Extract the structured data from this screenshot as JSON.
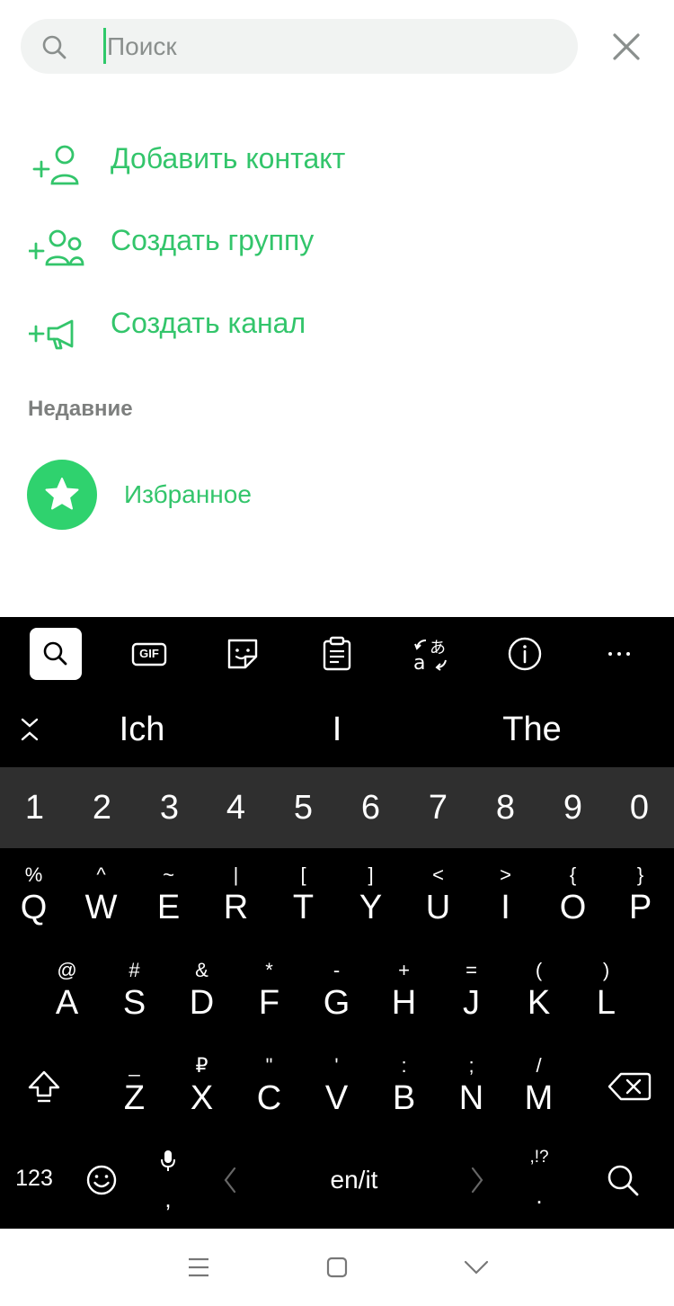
{
  "search": {
    "placeholder": "Поиск"
  },
  "actions": [
    {
      "label": "Добавить контакт",
      "icon": "add-contact-icon"
    },
    {
      "label": "Создать группу",
      "icon": "add-group-icon"
    },
    {
      "label": "Создать канал",
      "icon": "add-channel-icon"
    }
  ],
  "recent": {
    "title": "Недавние",
    "items": [
      {
        "label": "Избранное",
        "icon": "star-icon"
      }
    ]
  },
  "keyboard": {
    "toolbar": [
      "search-icon",
      "gif-icon",
      "sticker-icon",
      "clipboard-icon",
      "translate-icon",
      "info-icon",
      "more-icon"
    ],
    "gif_label": "GIF",
    "suggestions": [
      "Ich",
      "I",
      "The"
    ],
    "numbers": [
      "1",
      "2",
      "3",
      "4",
      "5",
      "6",
      "7",
      "8",
      "9",
      "0"
    ],
    "row1": [
      {
        "main": "Q",
        "sec": "%"
      },
      {
        "main": "W",
        "sec": "^"
      },
      {
        "main": "E",
        "sec": "~"
      },
      {
        "main": "R",
        "sec": "|"
      },
      {
        "main": "T",
        "sec": "["
      },
      {
        "main": "Y",
        "sec": "]"
      },
      {
        "main": "U",
        "sec": "<"
      },
      {
        "main": "I",
        "sec": ">"
      },
      {
        "main": "O",
        "sec": "{"
      },
      {
        "main": "P",
        "sec": "}"
      }
    ],
    "row2": [
      {
        "main": "A",
        "sec": "@"
      },
      {
        "main": "S",
        "sec": "#"
      },
      {
        "main": "D",
        "sec": "&"
      },
      {
        "main": "F",
        "sec": "*"
      },
      {
        "main": "G",
        "sec": "-"
      },
      {
        "main": "H",
        "sec": "+"
      },
      {
        "main": "J",
        "sec": "="
      },
      {
        "main": "K",
        "sec": "("
      },
      {
        "main": "L",
        "sec": ")"
      }
    ],
    "row3": [
      {
        "main": "Z",
        "sec": "_"
      },
      {
        "main": "X",
        "sec": "₽"
      },
      {
        "main": "C",
        "sec": "\""
      },
      {
        "main": "V",
        "sec": "'"
      },
      {
        "main": "B",
        "sec": ":"
      },
      {
        "main": "N",
        "sec": ";"
      },
      {
        "main": "M",
        "sec": "/"
      }
    ],
    "bottom": {
      "numbers_label": "123",
      "comma": ",",
      "language": "en/it",
      "punct_hint": ",!?",
      "period": "."
    }
  },
  "colors": {
    "accent": "#33c56b",
    "keyboard_bg": "#000000",
    "number_row_bg": "#2f2f2f"
  }
}
